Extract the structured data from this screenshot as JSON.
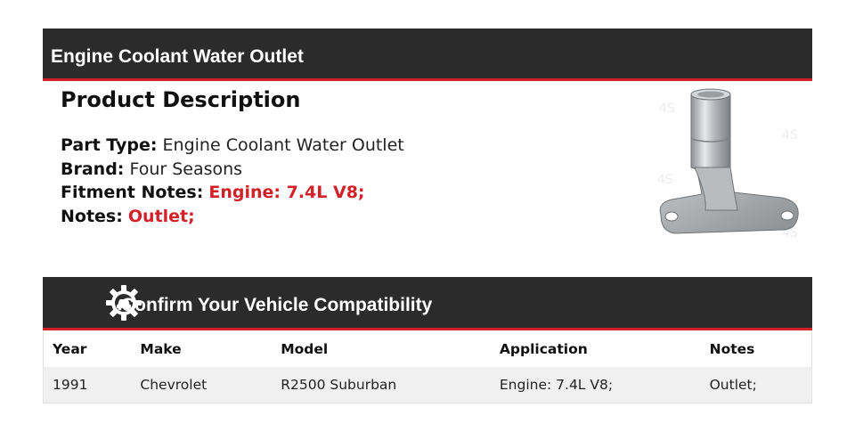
{
  "header": {
    "title": "Engine Coolant Water Outlet"
  },
  "description": {
    "title": "Product Description",
    "lines": [
      {
        "label": "Part Type:",
        "value": "Engine Coolant Water Outlet",
        "highlight": false
      },
      {
        "label": "Brand:",
        "value": "Four Seasons",
        "highlight": false
      },
      {
        "label": "Fitment Notes:",
        "value": "Engine: 7.4L V8;",
        "highlight": true
      },
      {
        "label": "Notes:",
        "value": "Outlet;",
        "highlight": true
      }
    ]
  },
  "compatibility": {
    "title": "Confirm Your Vehicle Compatibility",
    "icon": "gear-car-icon",
    "columns": [
      "Year",
      "Make",
      "Model",
      "Application",
      "Notes"
    ],
    "rows": [
      [
        "1991",
        "Chevrolet",
        "R2500 Suburban",
        "Engine: 7.4L V8;",
        "Outlet;"
      ]
    ]
  },
  "colors": {
    "bar": "#2b2b2b",
    "accent": "#d22128",
    "row": "#f0f0f0"
  }
}
